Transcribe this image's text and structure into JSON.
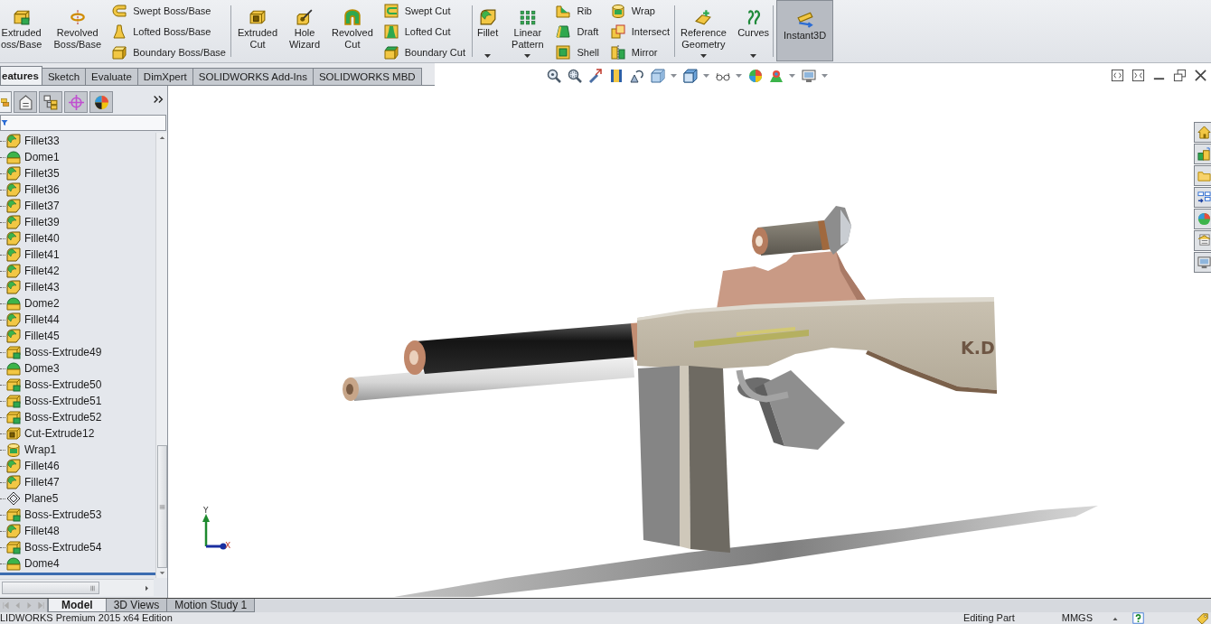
{
  "command_manager": {
    "groups": [
      {
        "items": [
          {
            "kind": "large",
            "lines": [
              "Extruded",
              "oss/Base"
            ],
            "dropdown": false
          },
          {
            "kind": "large",
            "lines": [
              "Revolved",
              "Boss/Base"
            ],
            "dropdown": false
          },
          {
            "kind": "stack",
            "entries": [
              "Swept Boss/Base",
              "Lofted Boss/Base",
              "Boundary Boss/Base"
            ]
          }
        ]
      },
      {
        "items": [
          {
            "kind": "large",
            "lines": [
              "Extruded",
              "Cut"
            ],
            "dropdown": false
          },
          {
            "kind": "large",
            "lines": [
              "Hole",
              "Wizard"
            ],
            "dropdown": false
          },
          {
            "kind": "large",
            "lines": [
              "Revolved",
              "Cut"
            ],
            "dropdown": false
          },
          {
            "kind": "stack",
            "entries": [
              "Swept Cut",
              "Lofted Cut",
              "Boundary Cut"
            ]
          }
        ]
      },
      {
        "items": [
          {
            "kind": "large",
            "lines": [
              "Fillet"
            ],
            "dropdown": true
          },
          {
            "kind": "large",
            "lines": [
              "Linear",
              "Pattern"
            ],
            "dropdown": true
          },
          {
            "kind": "stack",
            "entries": [
              "Rib",
              "Draft",
              "Shell"
            ]
          },
          {
            "kind": "stack",
            "entries": [
              "Wrap",
              "Intersect",
              "Mirror"
            ]
          }
        ]
      },
      {
        "items": [
          {
            "kind": "large",
            "lines": [
              "Reference",
              "Geometry"
            ],
            "dropdown": true
          },
          {
            "kind": "large",
            "lines": [
              "Curves"
            ],
            "dropdown": true
          }
        ]
      },
      {
        "items": [
          {
            "kind": "toggle",
            "lines": [
              "Instant3D"
            ],
            "on": true
          }
        ]
      }
    ]
  },
  "tabs": [
    {
      "label": "eatures",
      "selected": true
    },
    {
      "label": "Sketch",
      "selected": false
    },
    {
      "label": "Evaluate",
      "selected": false
    },
    {
      "label": "DimXpert",
      "selected": false
    },
    {
      "label": "SOLIDWORKS Add-Ins",
      "selected": false
    },
    {
      "label": "SOLIDWORKS MBD",
      "selected": false
    }
  ],
  "view_toolbar": [
    {
      "dropdown": false
    },
    {
      "dropdown": false
    },
    {
      "dropdown": false
    },
    {
      "dropdown": false
    },
    {
      "dropdown": false
    },
    {
      "dropdown": true
    },
    {
      "dropdown": true
    },
    {
      "dropdown": true
    },
    {
      "dropdown": false
    },
    {
      "dropdown": true
    },
    {
      "dropdown": true
    }
  ],
  "panel_tabs": [
    {
      "selected": true
    },
    {
      "selected": false
    },
    {
      "selected": false
    },
    {
      "selected": false
    },
    {
      "selected": false
    }
  ],
  "feature_tree": {
    "items": [
      {
        "label": "Fillet33",
        "kind": "fillet"
      },
      {
        "label": "Dome1",
        "kind": "dome"
      },
      {
        "label": "Fillet35",
        "kind": "fillet"
      },
      {
        "label": "Fillet36",
        "kind": "fillet"
      },
      {
        "label": "Fillet37",
        "kind": "fillet"
      },
      {
        "label": "Fillet39",
        "kind": "fillet"
      },
      {
        "label": "Fillet40",
        "kind": "fillet"
      },
      {
        "label": "Fillet41",
        "kind": "fillet"
      },
      {
        "label": "Fillet42",
        "kind": "fillet"
      },
      {
        "label": "Fillet43",
        "kind": "fillet"
      },
      {
        "label": "Dome2",
        "kind": "dome"
      },
      {
        "label": "Fillet44",
        "kind": "fillet"
      },
      {
        "label": "Fillet45",
        "kind": "fillet"
      },
      {
        "label": "Boss-Extrude49",
        "kind": "extrude"
      },
      {
        "label": "Dome3",
        "kind": "dome"
      },
      {
        "label": "Boss-Extrude50",
        "kind": "extrude"
      },
      {
        "label": "Boss-Extrude51",
        "kind": "extrude"
      },
      {
        "label": "Boss-Extrude52",
        "kind": "extrude"
      },
      {
        "label": "Cut-Extrude12",
        "kind": "cut"
      },
      {
        "label": "Wrap1",
        "kind": "wrap"
      },
      {
        "label": "Fillet46",
        "kind": "fillet"
      },
      {
        "label": "Fillet47",
        "kind": "fillet"
      },
      {
        "label": "Plane5",
        "kind": "plane"
      },
      {
        "label": "Boss-Extrude53",
        "kind": "extrude"
      },
      {
        "label": "Fillet48",
        "kind": "fillet"
      },
      {
        "label": "Boss-Extrude54",
        "kind": "extrude"
      },
      {
        "label": "Dome4",
        "kind": "dome"
      }
    ]
  },
  "model": {
    "engraving": "K.D"
  },
  "triad": {
    "y_label": "Y",
    "x_label": "X"
  },
  "bottom_tabs": [
    {
      "label": "Model",
      "selected": true
    },
    {
      "label": "3D Views",
      "selected": false
    },
    {
      "label": "Motion Study 1",
      "selected": false
    }
  ],
  "status_bar": {
    "product": "LIDWORKS Premium 2015 x64 Edition",
    "mode": "Editing Part",
    "units": "MMGS"
  }
}
